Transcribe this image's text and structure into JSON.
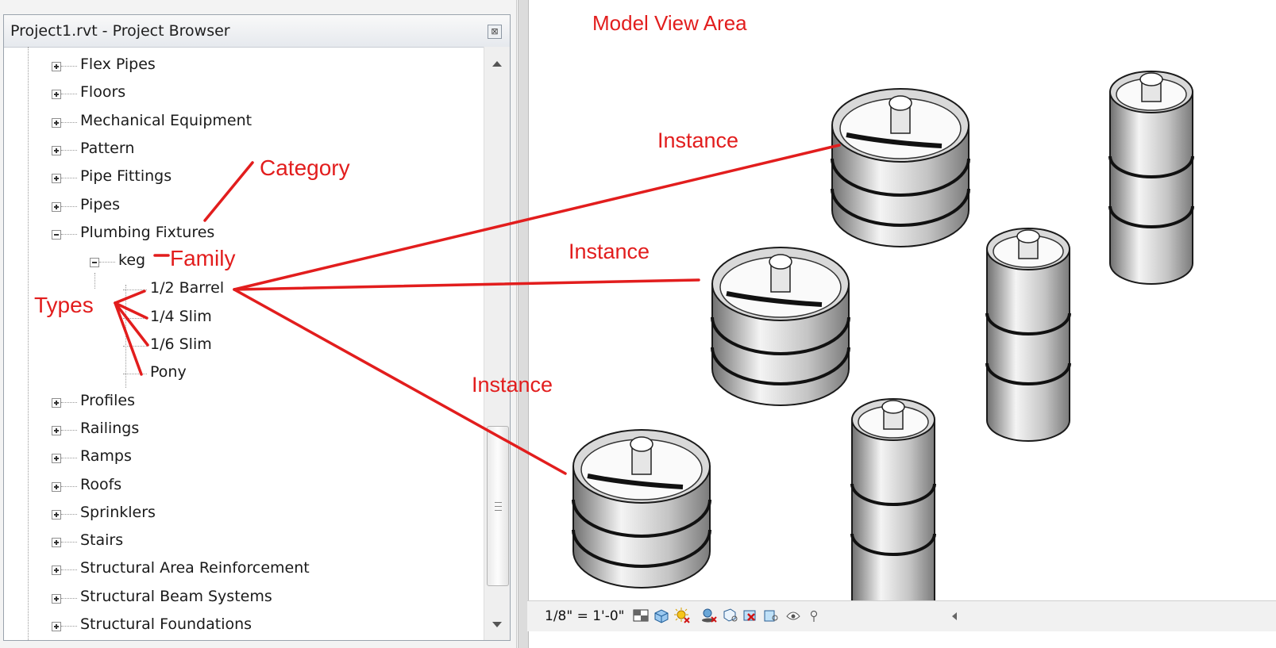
{
  "browser": {
    "title": "Project1.rvt - Project Browser",
    "close_glyph": "⊠"
  },
  "tree": {
    "items": [
      {
        "label": "Flex Pipes",
        "expander": "plus"
      },
      {
        "label": "Floors",
        "expander": "plus"
      },
      {
        "label": "Mechanical Equipment",
        "expander": "plus"
      },
      {
        "label": "Pattern",
        "expander": "plus"
      },
      {
        "label": "Pipe Fittings",
        "expander": "plus"
      },
      {
        "label": "Pipes",
        "expander": "plus"
      },
      {
        "label": "Plumbing Fixtures",
        "expander": "minus"
      },
      {
        "label": "keg",
        "expander": "minus"
      },
      {
        "label": "1/2 Barrel",
        "expander": "none"
      },
      {
        "label": "1/4 Slim",
        "expander": "none"
      },
      {
        "label": "1/6 Slim",
        "expander": "none"
      },
      {
        "label": "Pony",
        "expander": "none"
      },
      {
        "label": "Profiles",
        "expander": "plus"
      },
      {
        "label": "Railings",
        "expander": "plus"
      },
      {
        "label": "Ramps",
        "expander": "plus"
      },
      {
        "label": "Roofs",
        "expander": "plus"
      },
      {
        "label": "Sprinklers",
        "expander": "plus"
      },
      {
        "label": "Stairs",
        "expander": "plus"
      },
      {
        "label": "Structural Area Reinforcement",
        "expander": "plus"
      },
      {
        "label": "Structural Beam Systems",
        "expander": "plus"
      },
      {
        "label": "Structural Foundations",
        "expander": "plus"
      }
    ]
  },
  "annotations": {
    "model_view_area": "Model View Area",
    "category": "Category",
    "family": "Family",
    "types": "Types",
    "instance_1": "Instance",
    "instance_2": "Instance",
    "instance_3": "Instance"
  },
  "statusbar": {
    "scale": "1/8\" = 1'-0\"",
    "icons": [
      "detail-level-icon",
      "visual-style-icon",
      "sun-path-icon",
      "shadows-icon",
      "crop-view-icon",
      "show-crop-icon",
      "temporary-hide-icon",
      "reveal-hidden-icon",
      "worksharing-icon",
      "analytical-model-icon"
    ]
  },
  "colors": {
    "annotation": "#e21d1d",
    "keg_metal": "#b9b9b9"
  }
}
